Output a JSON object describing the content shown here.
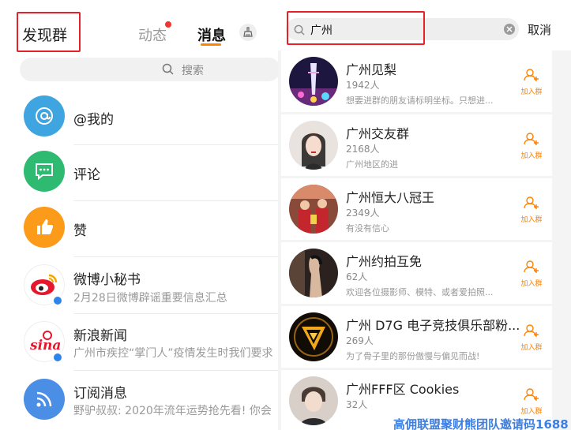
{
  "left": {
    "header": {
      "discover_label": "发现群",
      "tab_dongtai": "动态",
      "tab_xiaoxi": "消息",
      "clean_icon": "broom-icon"
    },
    "search": {
      "placeholder": "搜索"
    },
    "items": [
      {
        "title": "@我的",
        "icon": "at-icon",
        "color": "#3fa5e0"
      },
      {
        "title": "评论",
        "icon": "comment-icon",
        "color": "#2fba72"
      },
      {
        "title": "赞",
        "icon": "thumbs-up-icon",
        "color": "#fc9a19"
      },
      {
        "title": "微博小秘书",
        "subtitle": "2月28日微博辟谣重要信息汇总",
        "icon": "weibo-logo"
      },
      {
        "title": "新浪新闻",
        "subtitle": "广州市疾控“掌门人”疫情发生时我们要求",
        "icon": "sina-logo"
      },
      {
        "title": "订阅消息",
        "subtitle": "野驴叔叔: 2020年流年运势抢先看! 你会",
        "icon": "rss-icon",
        "color": "#4a8ee6"
      }
    ]
  },
  "right": {
    "search_query": "广州",
    "cancel_label": "取消",
    "join_label": "加入群",
    "groups": [
      {
        "name": "广州见梨",
        "count": "1942人",
        "desc": "想要进群的朋友请标明坐标。只想进..."
      },
      {
        "name": "广州交友群",
        "count": "2168人",
        "desc": "广州地区的进"
      },
      {
        "name": "广州恒大八冠王",
        "count": "2349人",
        "desc": "有没有信心"
      },
      {
        "name": "广州约拍互免",
        "count": "62人",
        "desc": "欢迎各位摄影师、模特、或者爱拍照..."
      },
      {
        "name": "广州 D7G 电子竞技俱乐部粉...",
        "count": "269人",
        "desc": "为了骨子里的那份傲慢与偏见而战!"
      },
      {
        "name": "广州FFF区 Cookies",
        "count": "32人",
        "desc": ""
      }
    ]
  },
  "watermark": "高佣联盟聚财熊团队邀请码1688",
  "colors": {
    "brand_orange": "#ff8200",
    "highlight_red": "#e8202a"
  }
}
